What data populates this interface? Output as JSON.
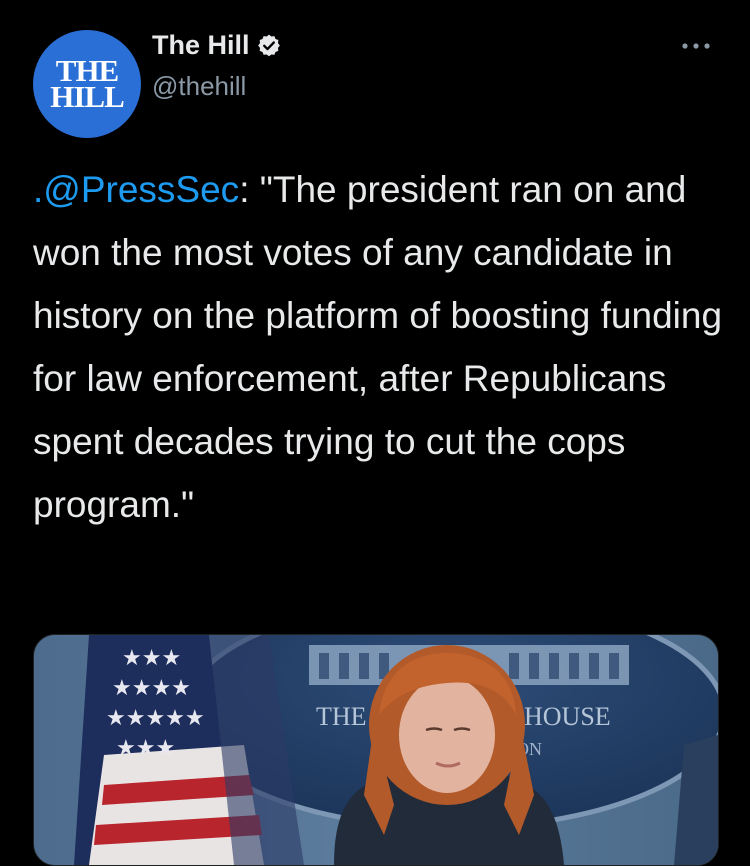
{
  "author": {
    "avatar_line1": "THE",
    "avatar_line2": "HILL",
    "display_name": "The Hill",
    "handle": "@thehill",
    "verified": true
  },
  "tweet": {
    "mention": ".@PressSec",
    "text_after_mention": ": \"The president ran on and won the most votes of any candidate in history on the platform of boosting funding for law enforcement, after Republicans spent decades trying to cut the cops program.\""
  },
  "media": {
    "seal_text_left": "THE",
    "seal_text_right": "HOUSE",
    "seal_text_lower": "ON"
  },
  "icons": {
    "verified": "verified-badge-icon",
    "more": "more-options-icon"
  },
  "colors": {
    "background": "#000000",
    "text": "#e7e9ea",
    "secondary_text": "#8b98a5",
    "link": "#1d9bf0",
    "avatar_bg": "#2a6fd6"
  }
}
